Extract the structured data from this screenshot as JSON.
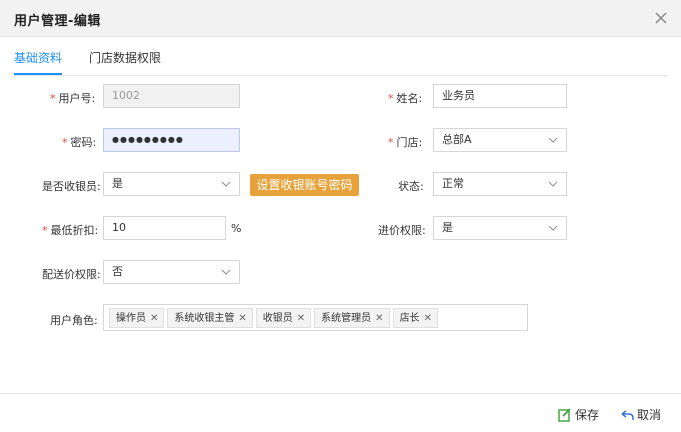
{
  "dialog": {
    "title": "用户管理-编辑"
  },
  "tabs": [
    {
      "label": "基础资料",
      "active": true
    },
    {
      "label": "门店数据权限",
      "active": false
    }
  ],
  "form": {
    "user_no": {
      "label": "用户号:",
      "value": "1002",
      "required": true
    },
    "name": {
      "label": "姓名:",
      "value": "业务员",
      "required": true
    },
    "password": {
      "label": "密码:",
      "value": "●●●●●●●●●",
      "required": true
    },
    "store": {
      "label": "门店:",
      "value": "总部A",
      "required": true
    },
    "is_cashier": {
      "label": "是否收银员:",
      "value": "是"
    },
    "set_cashier_pwd_button": "设置收银账号密码",
    "status": {
      "label": "状态:",
      "value": "正常"
    },
    "min_discount": {
      "label": "最低折扣:",
      "value": "10",
      "unit": "%",
      "required": true
    },
    "purchase_price_perm": {
      "label": "进价权限:",
      "value": "是"
    },
    "delivery_price_perm": {
      "label": "配送价权限:",
      "value": "否"
    },
    "roles": {
      "label": "用户角色:",
      "items": [
        "操作员",
        "系统收银主管",
        "收银员",
        "系统管理员",
        "店长"
      ]
    }
  },
  "footer": {
    "save_label": "保存",
    "cancel_label": "取消"
  },
  "colors": {
    "accent": "#1e90ff",
    "orange": "#e8a23b",
    "required": "#e8453c"
  },
  "icons": {
    "close": "close-icon",
    "save": "save-icon",
    "cancel": "undo-icon",
    "dropdown": "chevron-down-icon"
  }
}
